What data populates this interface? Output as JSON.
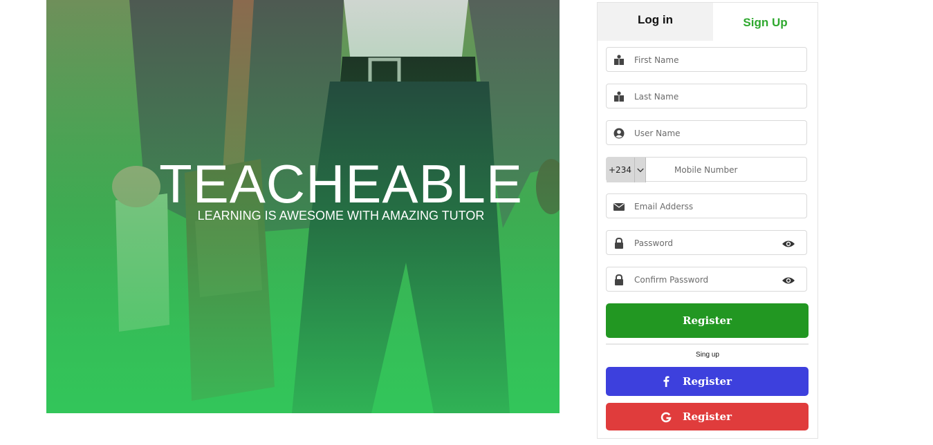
{
  "hero": {
    "title": "TEACHEABLE",
    "subtitle": "LEARNING IS AWESOME WITH AMAZING TUTOR"
  },
  "tabs": {
    "login": "Log in",
    "signup": "Sign Up"
  },
  "form": {
    "first_name": "First Name",
    "last_name": "Last Name",
    "user_name": "User Name",
    "country_code": "+234",
    "mobile": "Mobile Number",
    "email": "Email Adderss",
    "password": "Password",
    "confirm_password": "Confirm Password"
  },
  "actions": {
    "register": "Register",
    "sing_up": "Sing up",
    "facebook_register": "Register",
    "google_register": "Register"
  },
  "icons": {
    "first_name": "id-card-icon",
    "last_name": "id-card-icon",
    "user_name": "user-circle-icon",
    "email": "envelope-icon",
    "password": "lock-icon",
    "show_password": "eye-icon",
    "facebook": "facebook-icon",
    "google": "google-icon"
  },
  "colors": {
    "accent": "#2ea82e",
    "register": "#229722",
    "facebook": "#3d40dd",
    "google": "#e03c3c"
  }
}
